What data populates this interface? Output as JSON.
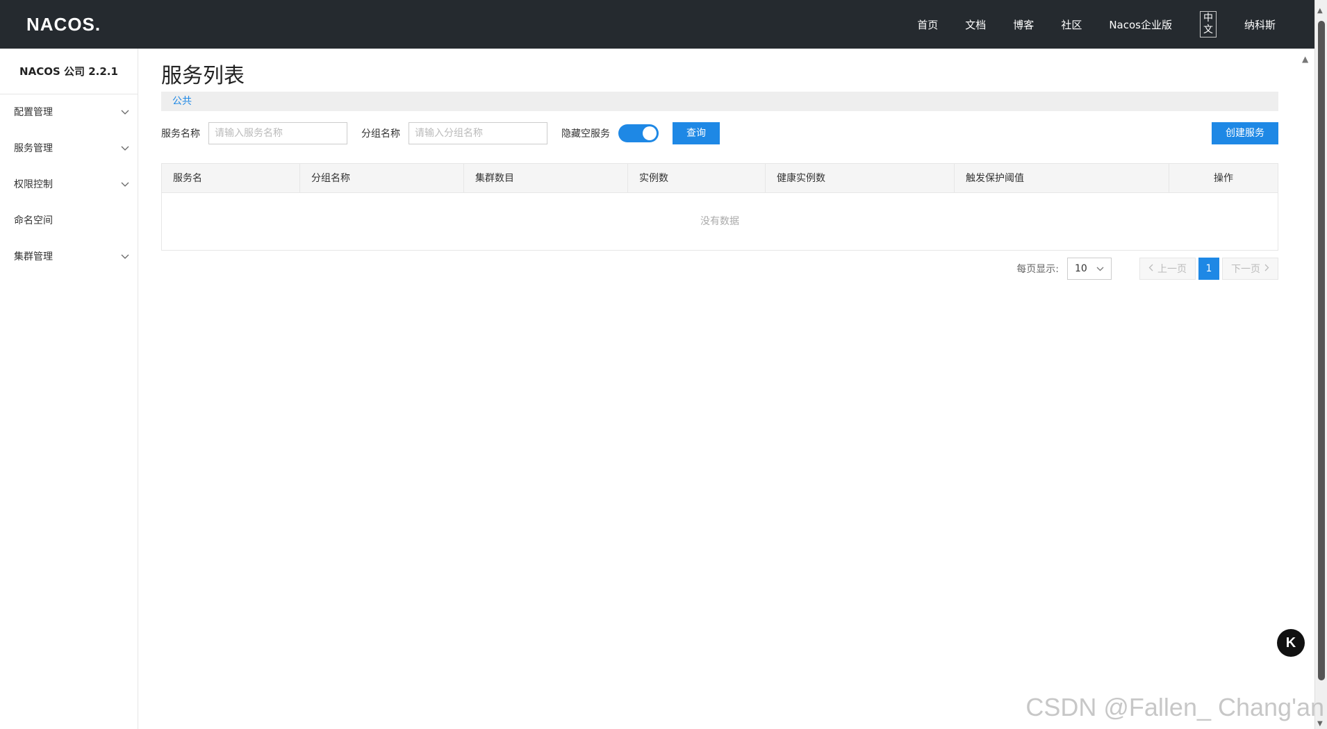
{
  "header": {
    "logo_text": "NACOS.",
    "nav": [
      "首页",
      "文档",
      "博客",
      "社区",
      "Nacos企业版"
    ],
    "lang_label": "中文",
    "user": "纳科斯"
  },
  "sidebar": {
    "title": "NACOS 公司 2.2.1",
    "items": [
      {
        "label": "配置管理",
        "expandable": true
      },
      {
        "label": "服务管理",
        "expandable": true
      },
      {
        "label": "权限控制",
        "expandable": true
      },
      {
        "label": "命名空间",
        "expandable": false
      },
      {
        "label": "集群管理",
        "expandable": true
      }
    ]
  },
  "main": {
    "title": "服务列表",
    "namespace": "公共",
    "filters": {
      "service_name_label": "服务名称",
      "service_name_placeholder": "请输入服务名称",
      "group_name_label": "分组名称",
      "group_name_placeholder": "请输入分组名称",
      "hide_empty_label": "隐藏空服务",
      "hide_empty_on": true,
      "query_button": "查询",
      "create_button": "创建服务"
    },
    "table": {
      "columns": [
        "服务名",
        "分组名称",
        "集群数目",
        "实例数",
        "健康实例数",
        "触发保护阈值",
        "操作"
      ],
      "rows": [],
      "empty_text": "没有数据"
    },
    "pagination": {
      "page_size_label": "每页显示:",
      "page_size": "10",
      "prev_label": "上一页",
      "current_page": "1",
      "next_label": "下一页"
    }
  },
  "float_button": "K",
  "watermark": "CSDN @Fallen_ Chang'an",
  "colors": {
    "topbar_bg": "#252a2f",
    "accent": "#1e88e5"
  }
}
